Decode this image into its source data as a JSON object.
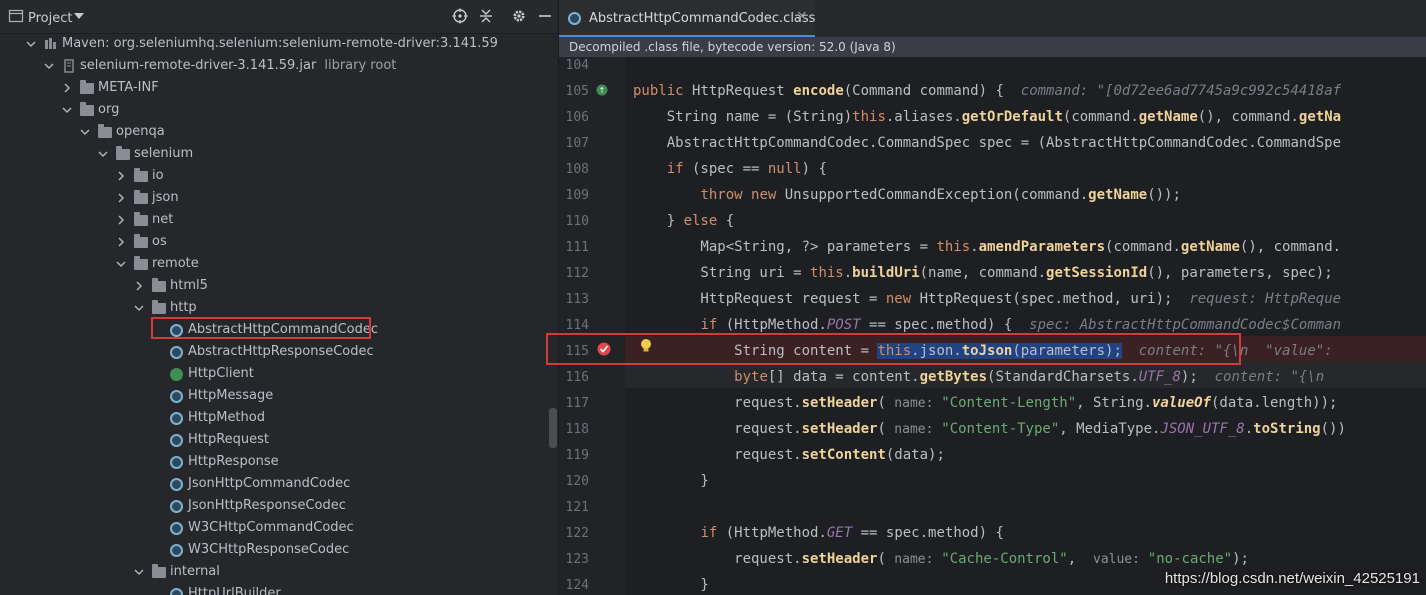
{
  "project": {
    "title": "Project",
    "tree": [
      {
        "label": "Maven: org.seleniumhq.selenium:selenium-remote-driver:3.141.59",
        "kind": "maven"
      },
      {
        "label": "selenium-remote-driver-3.141.59.jar",
        "sub": "library root",
        "kind": "jar"
      },
      {
        "label": "META-INF",
        "kind": "folder"
      },
      {
        "label": "org",
        "kind": "folder"
      },
      {
        "label": "openqa",
        "kind": "folder"
      },
      {
        "label": "selenium",
        "kind": "folder"
      },
      {
        "label": "io",
        "kind": "folder"
      },
      {
        "label": "json",
        "kind": "folder"
      },
      {
        "label": "net",
        "kind": "folder"
      },
      {
        "label": "os",
        "kind": "folder"
      },
      {
        "label": "remote",
        "kind": "folder"
      },
      {
        "label": "html5",
        "kind": "folder"
      },
      {
        "label": "http",
        "kind": "folder"
      },
      {
        "label": "AbstractHttpCommandCodec",
        "kind": "class"
      },
      {
        "label": "AbstractHttpResponseCodec",
        "kind": "class"
      },
      {
        "label": "HttpClient",
        "kind": "interface"
      },
      {
        "label": "HttpMessage",
        "kind": "class"
      },
      {
        "label": "HttpMethod",
        "kind": "enum"
      },
      {
        "label": "HttpRequest",
        "kind": "class"
      },
      {
        "label": "HttpResponse",
        "kind": "class"
      },
      {
        "label": "JsonHttpCommandCodec",
        "kind": "class"
      },
      {
        "label": "JsonHttpResponseCodec",
        "kind": "class"
      },
      {
        "label": "W3CHttpCommandCodec",
        "kind": "class"
      },
      {
        "label": "W3CHttpResponseCodec",
        "kind": "class"
      },
      {
        "label": "internal",
        "kind": "folder"
      },
      {
        "label": "HttpUrlBuilder",
        "kind": "class"
      }
    ]
  },
  "editor": {
    "tab_label": "AbstractHttpCommandCodec.class",
    "tab_close": "×",
    "banner": "Decompiled .class file, bytecode version: 52.0 (Java 8)",
    "line_numbers": [
      "104",
      "105",
      "106",
      "107",
      "108",
      "109",
      "110",
      "111",
      "112",
      "113",
      "114",
      "115",
      "116",
      "117",
      "118",
      "119",
      "120",
      "121",
      "122",
      "123",
      "124"
    ],
    "code": {
      "l105_a": "public ",
      "l105_b": "HttpRequest ",
      "l105_c": "encode",
      "l105_d": "(Command command) {  ",
      "l105_hint": "command: \"[0d72ee6ad7745a9c992c54418af",
      "l106_a": "    String name = (String)",
      "l106_b": "this",
      "l106_c": ".aliases.",
      "l106_d": "getOrDefault",
      "l106_e": "(command.",
      "l106_f": "getName",
      "l106_g": "(), command.",
      "l106_h": "getNa",
      "l107": "    AbstractHttpCommandCodec.CommandSpec spec = (AbstractHttpCommandCodec.CommandSpe",
      "l108_a": "    ",
      "l108_b": "if",
      "l108_c": " (spec == ",
      "l108_d": "null",
      "l108_e": ") {",
      "l109_a": "        ",
      "l109_b": "throw new",
      "l109_c": " UnsupportedCommandException(command.",
      "l109_d": "getName",
      "l109_e": "());",
      "l110_a": "    } ",
      "l110_b": "else",
      "l110_c": " {",
      "l111_a": "        Map<String, ?> parameters = ",
      "l111_b": "this",
      "l111_c": ".",
      "l111_d": "amendParameters",
      "l111_e": "(command.",
      "l111_f": "getName",
      "l111_g": "(), command.",
      "l112_a": "        String uri = ",
      "l112_b": "this",
      "l112_c": ".",
      "l112_d": "buildUri",
      "l112_e": "(name, command.",
      "l112_f": "getSessionId",
      "l112_g": "(), parameters, spec);",
      "l113_a": "        HttpRequest request = ",
      "l113_b": "new",
      "l113_c": " HttpRequest(spec.method, uri);  ",
      "l113_hint": "request: HttpReque",
      "l114_a": "        ",
      "l114_b": "if",
      "l114_c": " (HttpMethod.",
      "l114_d": "POST",
      "l114_e": " == spec.method) {  ",
      "l114_hint": "spec: AbstractHttpCommandCodec$Comman",
      "l115_a": "            String content = ",
      "l115_b": "this",
      "l115_c": ".json.",
      "l115_d": "toJson",
      "l115_e": "(parameters);",
      "l115_hint": "  content: \"{\\n  \"value\":",
      "l116_a": "            ",
      "l116_b": "byte",
      "l116_c": "[] data = content.",
      "l116_d": "getBytes",
      "l116_e": "(StandardCharsets.",
      "l116_f": "UTF_8",
      "l116_g": ");  ",
      "l116_hint": "content: \"{\\n",
      "l117_a": "            request.",
      "l117_b": "setHeader",
      "l117_c": "( ",
      "l117_p": "name: ",
      "l117_d": "\"Content-Length\"",
      "l117_e": ", String.",
      "l117_f": "valueOf",
      "l117_g": "(data.length));",
      "l118_a": "            request.",
      "l118_b": "setHeader",
      "l118_c": "( ",
      "l118_p": "name: ",
      "l118_d": "\"Content-Type\"",
      "l118_e": ", MediaType.",
      "l118_f": "JSON_UTF_8",
      "l118_g": ".",
      "l118_h": "toString",
      "l118_i": "())",
      "l119_a": "            request.",
      "l119_b": "setContent",
      "l119_c": "(data);",
      "l120": "        }",
      "l122_a": "        ",
      "l122_b": "if",
      "l122_c": " (HttpMethod.",
      "l122_d": "GET",
      "l122_e": " == spec.method) {",
      "l123_a": "            request.",
      "l123_b": "setHeader",
      "l123_c": "( ",
      "l123_p": "name: ",
      "l123_d": "\"Cache-Control\"",
      "l123_e": ",  ",
      "l123_p2": "value: ",
      "l123_f": "\"no-cache\"",
      "l123_g": ");",
      "l124": "        }"
    }
  },
  "watermark": "https://blog.csdn.net/weixin_42525191",
  "colors": {
    "accent": "#4a8ae0",
    "highlight_border": "#d33a3a",
    "breakpoint": "#e0474c"
  }
}
